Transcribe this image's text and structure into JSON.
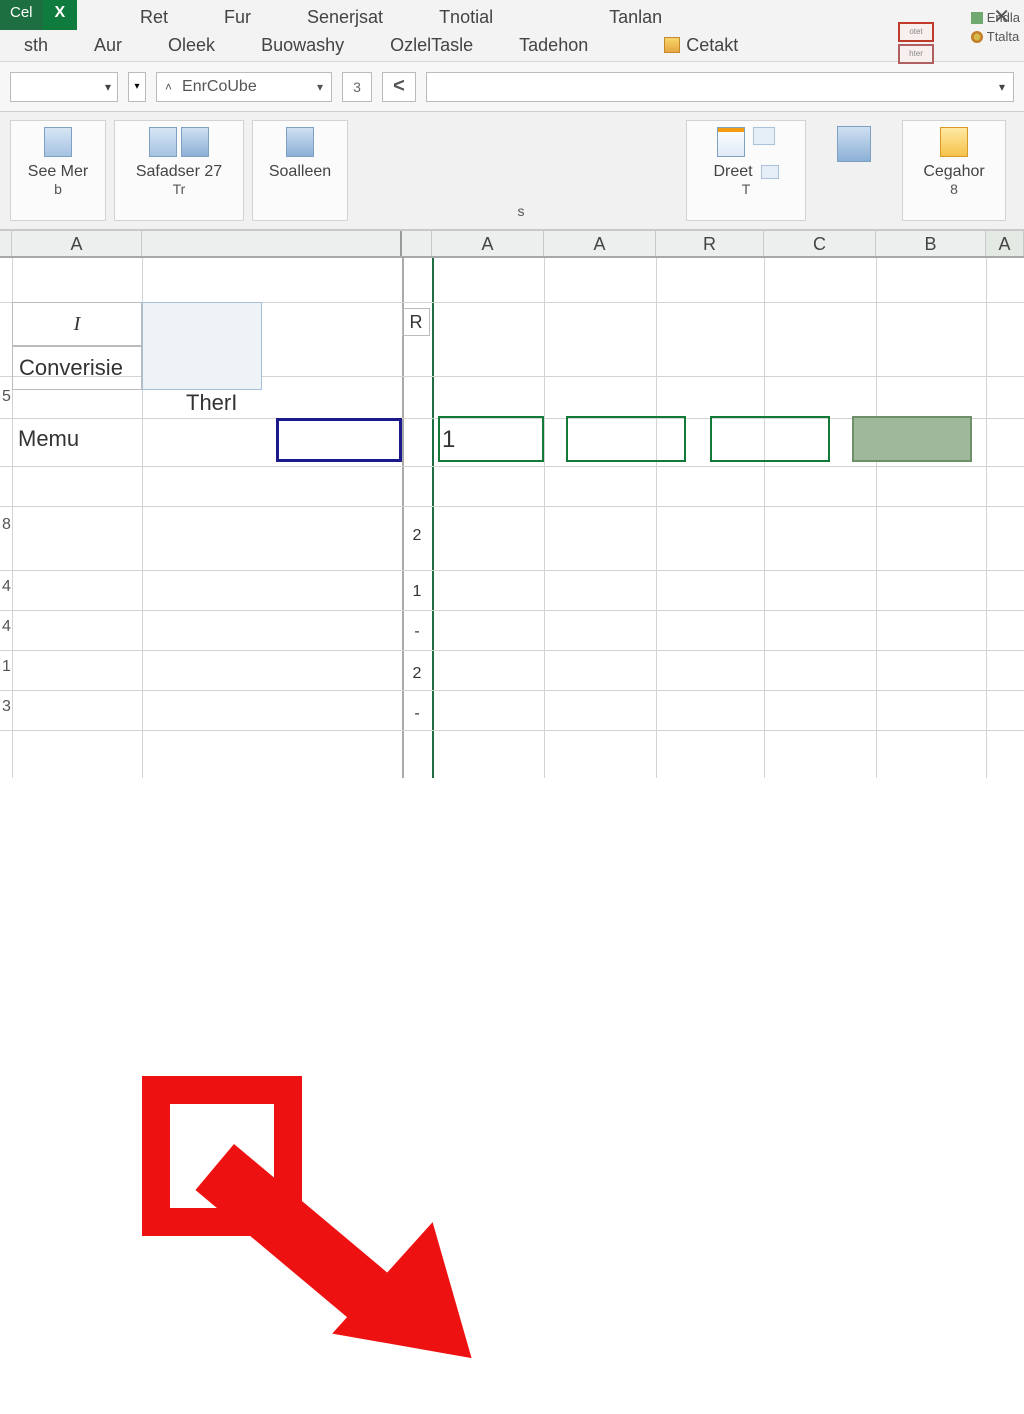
{
  "app": {
    "badge1": "Cel",
    "badge2": "X"
  },
  "tabs_row1": [
    "Ret",
    "Fur",
    "Senerjsat",
    "Tnotial",
    "Tanlan"
  ],
  "tabs_row2": [
    "sth",
    "Aur",
    "Oleek",
    "Buowashy",
    "OzlelTasle",
    "Tadehon",
    "Cetakt"
  ],
  "right_side": {
    "l1": "Endla",
    "l2": "Ttalta"
  },
  "smallpane1": "otet",
  "smallpane2": "hter",
  "fx": {
    "fn_label": "EnrCoUbe",
    "num": "3",
    "back": "<"
  },
  "ribbon": {
    "g1": {
      "l1": "See  Mer",
      "sub": "b"
    },
    "g2": {
      "l1": "Safadser  27",
      "sub": "Tr"
    },
    "g3": {
      "l1": "Soalleen",
      "sub": ""
    },
    "mid_sub": "s",
    "g4": {
      "l1": "Dreet",
      "sub": "T"
    },
    "g5": {
      "l1": "Cegahor",
      "sub": "8"
    }
  },
  "cols": {
    "a1": "A",
    "mid1": "A",
    "mid2": "A",
    "r": "R",
    "c": "C",
    "b": "B",
    "a2": "A"
  },
  "cells": {
    "I": "I",
    "Converise": "Converisie",
    "TherI": "TherI",
    "Memu": "Memu",
    "R": "R",
    "one": "1",
    "two": "2",
    "one_b": "1",
    "two_b": "2"
  },
  "rows_left": [
    "5",
    "8",
    "4",
    "4",
    "1",
    "3"
  ]
}
